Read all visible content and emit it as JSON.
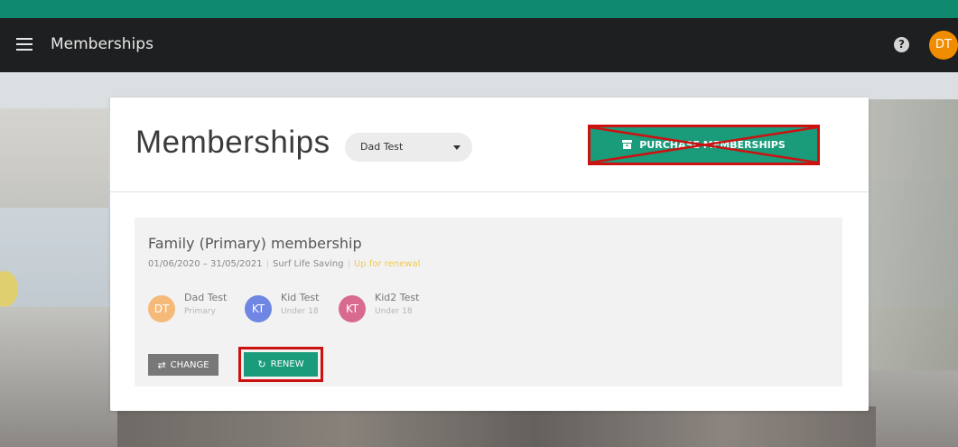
{
  "appbar": {
    "title": "Memberships",
    "help_icon_glyph": "?",
    "user_initials": "DT"
  },
  "colors": {
    "accent": "#0f8a6e",
    "primary_button": "#1a9b7a",
    "appbar": "#1e1f20",
    "highlight_outline": "#cc1111",
    "status_warning": "#f2c94c"
  },
  "card": {
    "title": "Memberships",
    "member_select": {
      "value": "Dad Test"
    },
    "purchase_button_label": "PURCHASE MEMBERSHIPS"
  },
  "membership": {
    "title": "Family (Primary) membership",
    "dates": "01/06/2020 – 31/05/2021",
    "organisation": "Surf Life Saving",
    "status": "Up for renewal",
    "members": [
      {
        "initials": "DT",
        "name": "Dad Test",
        "role": "Primary",
        "color": "#f5b97a"
      },
      {
        "initials": "KT",
        "name": "Kid Test",
        "role": "Under 18",
        "color": "#6f86e3"
      },
      {
        "initials": "KT",
        "name": "Kid2 Test",
        "role": "Under 18",
        "color": "#d8698f"
      }
    ],
    "change_label": "CHANGE",
    "renew_label": "RENEW"
  }
}
